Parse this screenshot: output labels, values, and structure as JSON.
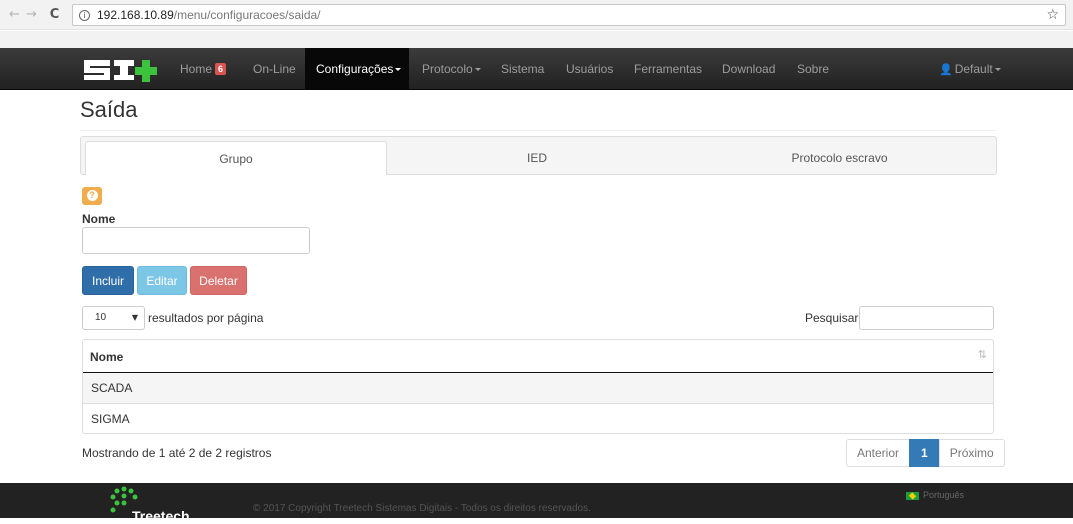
{
  "browser": {
    "url_host": "192.168.10.89",
    "url_path": "/menu/configuracoes/saida/"
  },
  "navbar": {
    "brand": "S1+",
    "items": [
      {
        "label": "Home",
        "badge": "6"
      },
      {
        "label": "On-Line"
      },
      {
        "label": "Configurações",
        "dropdown": true,
        "active": true
      },
      {
        "label": "Protocolo",
        "dropdown": true
      },
      {
        "label": "Sistema"
      },
      {
        "label": "Usuários"
      },
      {
        "label": "Ferramentas"
      },
      {
        "label": "Download"
      },
      {
        "label": "Sobre"
      }
    ],
    "user": "Default"
  },
  "page": {
    "title": "Saída",
    "tabs": [
      {
        "label": "Grupo",
        "active": true
      },
      {
        "label": "IED"
      },
      {
        "label": "Protocolo escravo"
      }
    ]
  },
  "form": {
    "name_label": "Nome",
    "name_value": "",
    "buttons": {
      "include": "Incluir",
      "edit": "Editar",
      "delete": "Deletar"
    }
  },
  "table_controls": {
    "page_length": "10",
    "page_length_label": "resultados por página",
    "search_label": "Pesquisar",
    "search_value": ""
  },
  "table": {
    "columns": [
      "Nome"
    ],
    "rows": [
      "SCADA",
      "SIGMA"
    ]
  },
  "pagination": {
    "info": "Mostrando de 1 até 2 de 2 registros",
    "previous": "Anterior",
    "current": "1",
    "next": "Próximo"
  },
  "footer": {
    "brand": "Treetech",
    "copyright": "© 2017 Copyright Treetech Sistemas Digitais - Todos os direitos reservados.",
    "language": "Português"
  },
  "colors": {
    "navbar": "#222222",
    "primary": "#2f6ea8",
    "info": "#7cc7e6",
    "danger": "#d9726f",
    "warning": "#f0ad4e",
    "logo_green": "#3cc23c"
  }
}
